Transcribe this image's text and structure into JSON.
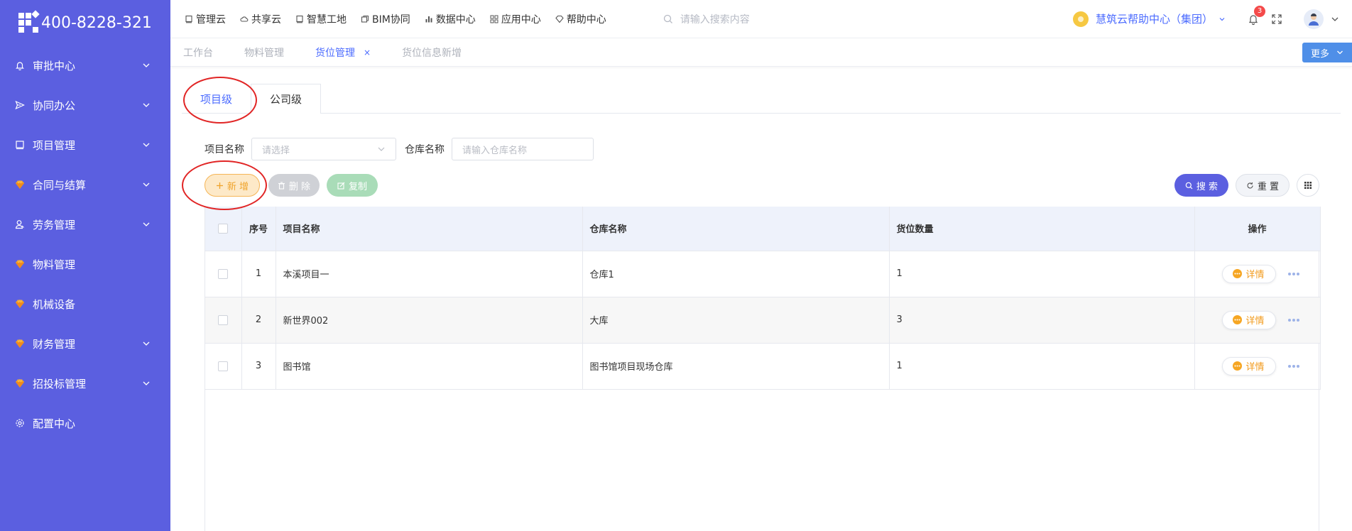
{
  "brand": {
    "phone": "400-8228-321"
  },
  "sidebar": {
    "items": [
      {
        "label": "审批中心",
        "icon": "bell-icon",
        "has_arrow": true
      },
      {
        "label": "协同办公",
        "icon": "send-icon",
        "has_arrow": true
      },
      {
        "label": "项目管理",
        "icon": "book-icon",
        "has_arrow": true
      },
      {
        "label": "合同与结算",
        "icon": "gem-icon",
        "has_arrow": true
      },
      {
        "label": "劳务管理",
        "icon": "user-icon",
        "has_arrow": true
      },
      {
        "label": "物料管理",
        "icon": "gem-icon",
        "has_arrow": false
      },
      {
        "label": "机械设备",
        "icon": "gem-icon",
        "has_arrow": false
      },
      {
        "label": "财务管理",
        "icon": "gem-icon",
        "has_arrow": true
      },
      {
        "label": "招投标管理",
        "icon": "gem-icon",
        "has_arrow": true
      },
      {
        "label": "配置中心",
        "icon": "gear-icon",
        "has_arrow": false
      }
    ]
  },
  "topnav": {
    "items": [
      {
        "label": "管理云",
        "icon": "book-icon"
      },
      {
        "label": "共享云",
        "icon": "cloud-icon"
      },
      {
        "label": "智慧工地",
        "icon": "book-icon"
      },
      {
        "label": "BIM协同",
        "icon": "cube-icon"
      },
      {
        "label": "数据中心",
        "icon": "bar-chart-icon"
      },
      {
        "label": "应用中心",
        "icon": "grid-icon"
      },
      {
        "label": "帮助中心",
        "icon": "diamond-icon"
      }
    ],
    "search_placeholder": "请输入搜索内容",
    "org_name": "慧筑云帮助中心（集团）",
    "notification_count": "3"
  },
  "pagetabs": {
    "items": [
      {
        "label": "工作台",
        "active": false
      },
      {
        "label": "物料管理",
        "active": false
      },
      {
        "label": "货位管理",
        "active": true,
        "closable": true
      },
      {
        "label": "货位信息新增",
        "active": false
      }
    ],
    "close_glyph": "×",
    "more_label": "更多"
  },
  "subtabs": {
    "project": "项目级",
    "company": "公司级"
  },
  "filter": {
    "project_label": "项目名称",
    "project_placeholder": "请选择",
    "warehouse_label": "仓库名称",
    "warehouse_placeholder": "请输入仓库名称"
  },
  "actions": {
    "add": "新 增",
    "delete": "删 除",
    "copy": "复制",
    "search": "搜 索",
    "reset": "重 置"
  },
  "table": {
    "headers": {
      "index": "序号",
      "project": "项目名称",
      "warehouse": "仓库名称",
      "count": "货位数量",
      "ops": "操作"
    },
    "detail_label": "详情",
    "rows": [
      {
        "index": "1",
        "project": "本溪项目一",
        "warehouse": "仓库1",
        "count": "1"
      },
      {
        "index": "2",
        "project": "新世界002",
        "warehouse": "大库",
        "count": "3"
      },
      {
        "index": "3",
        "project": "图书馆",
        "warehouse": "图书馆项目现场仓库",
        "count": "1"
      }
    ]
  },
  "colors": {
    "sidebar_bg": "#5b5fe0",
    "accent": "#4b6bff",
    "add_orange": "#f0a42c",
    "annotation_red": "#e12525"
  }
}
